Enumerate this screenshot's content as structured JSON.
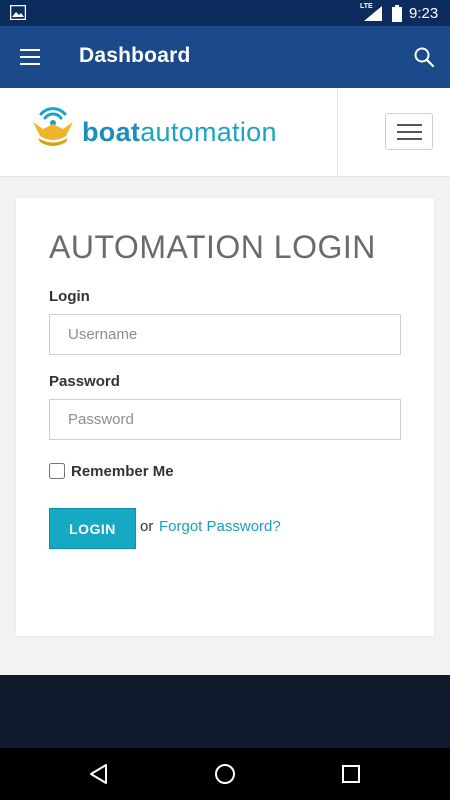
{
  "status_bar": {
    "network": "LTE",
    "time": "9:23",
    "icons": [
      "image-icon",
      "signal-icon",
      "battery-icon"
    ]
  },
  "app_bar": {
    "title": "Dashboard",
    "icons": [
      "menu-icon",
      "search-icon"
    ]
  },
  "site_header": {
    "logo": {
      "word_bold": "boat",
      "word_light": "automation"
    },
    "menu_icon": "hamburger-icon"
  },
  "login": {
    "heading": "AUTOMATION LOGIN",
    "login_label": "Login",
    "username_placeholder": "Username",
    "password_label": "Password",
    "password_placeholder": "Password",
    "remember_label": "Remember Me",
    "remember_checked": false,
    "button_label": "LOGIN",
    "or_text": "or",
    "forgot_link": "Forgot Password?"
  },
  "colors": {
    "status_bar": "#0d2c5e",
    "app_bar": "#1a4a8a",
    "accent": "#17a9c3",
    "link": "#1a9ec0",
    "footer": "#0f1b2c"
  },
  "nav_bar": {
    "icons": [
      "back-icon",
      "home-icon",
      "recents-icon"
    ]
  }
}
